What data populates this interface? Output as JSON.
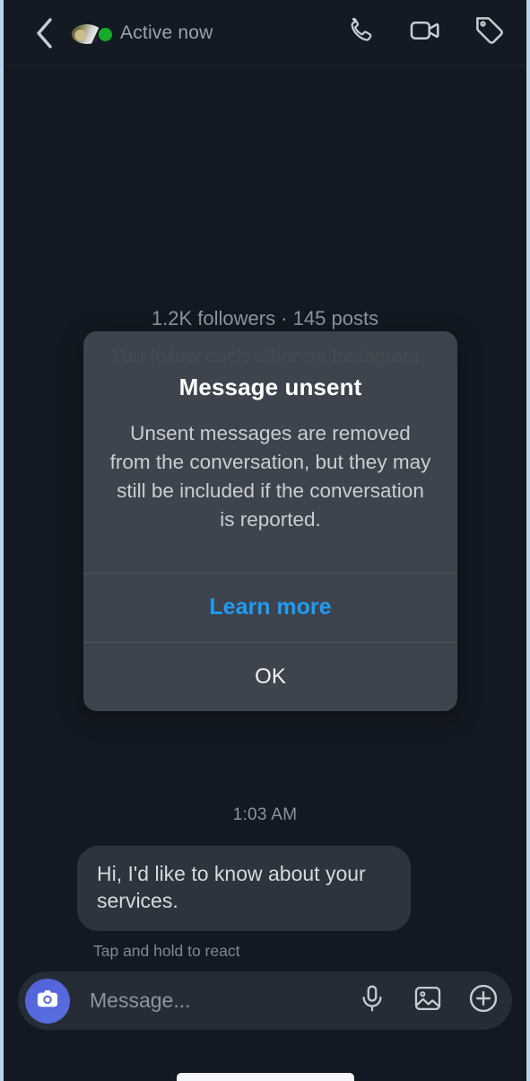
{
  "header": {
    "back_icon": "chevron-left-icon",
    "status_text": "Active now",
    "avatar": "contact-avatar",
    "actions": [
      {
        "name": "audio-call-button",
        "icon": "phone-icon"
      },
      {
        "name": "video-call-button",
        "icon": "video-camera-icon"
      },
      {
        "name": "tag-button",
        "icon": "tag-icon"
      }
    ]
  },
  "conversation": {
    "profile_meta": "1.2K followers · 145 posts",
    "mutual_note": "You follow each other on Instagram",
    "timestamp": "1:03 AM",
    "message_text": "Hi, I'd like to know about your services.",
    "react_hint": "Tap and hold to react"
  },
  "dialog": {
    "title": "Message unsent",
    "body": "Unsent messages are removed from the conversation, but they may still be included if the conversation is reported.",
    "learn_more_label": "Learn more",
    "ok_label": "OK",
    "accent_color": "#1f9cf5"
  },
  "composer": {
    "camera_icon": "camera-icon",
    "placeholder": "Message...",
    "value": "",
    "actions": [
      {
        "name": "voice-message-button",
        "icon": "microphone-icon"
      },
      {
        "name": "gallery-button",
        "icon": "image-icon"
      },
      {
        "name": "more-options-button",
        "icon": "plus-circle-icon"
      }
    ]
  }
}
